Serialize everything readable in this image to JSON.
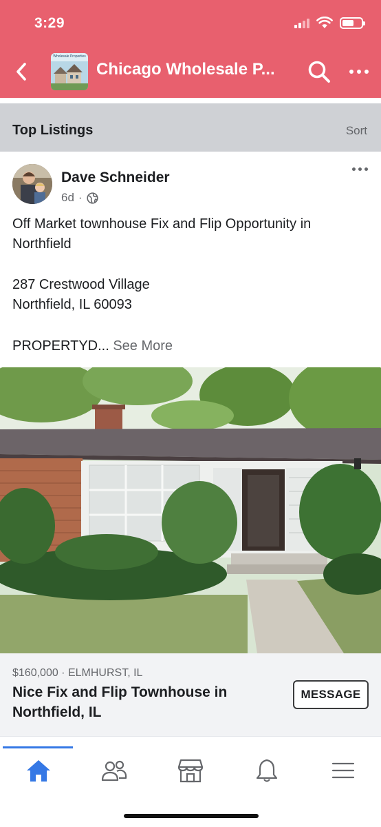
{
  "status": {
    "time": "3:29"
  },
  "header": {
    "group_title": "Chicago Wholesale P...",
    "thumb_caption": "Wholesale Properties"
  },
  "section": {
    "title": "Top Listings",
    "sort_label": "Sort"
  },
  "post": {
    "author": "Dave Schneider",
    "age": "6d",
    "separator": "·",
    "lines": [
      "Off Market townhouse Fix and Flip Opportunity in Northfield",
      "287 Crestwood Village",
      "Northfield, IL 60093",
      "PROPERTYD..."
    ],
    "see_more": "See More"
  },
  "listing": {
    "price_location": "$160,000 · ELMHURST, IL",
    "title": "Nice Fix and Flip Townhouse in Northfield, IL",
    "message_label": "MESSAGE"
  },
  "nav": {
    "items": [
      {
        "icon": "home-icon",
        "active": true
      },
      {
        "icon": "people-icon",
        "active": false
      },
      {
        "icon": "marketplace-icon",
        "active": false
      },
      {
        "icon": "bell-icon",
        "active": false
      },
      {
        "icon": "menu-icon",
        "active": false
      }
    ],
    "active_color": "#3578e5"
  },
  "colors": {
    "header_bg": "#e8606e",
    "section_bg": "#cfd1d5"
  }
}
